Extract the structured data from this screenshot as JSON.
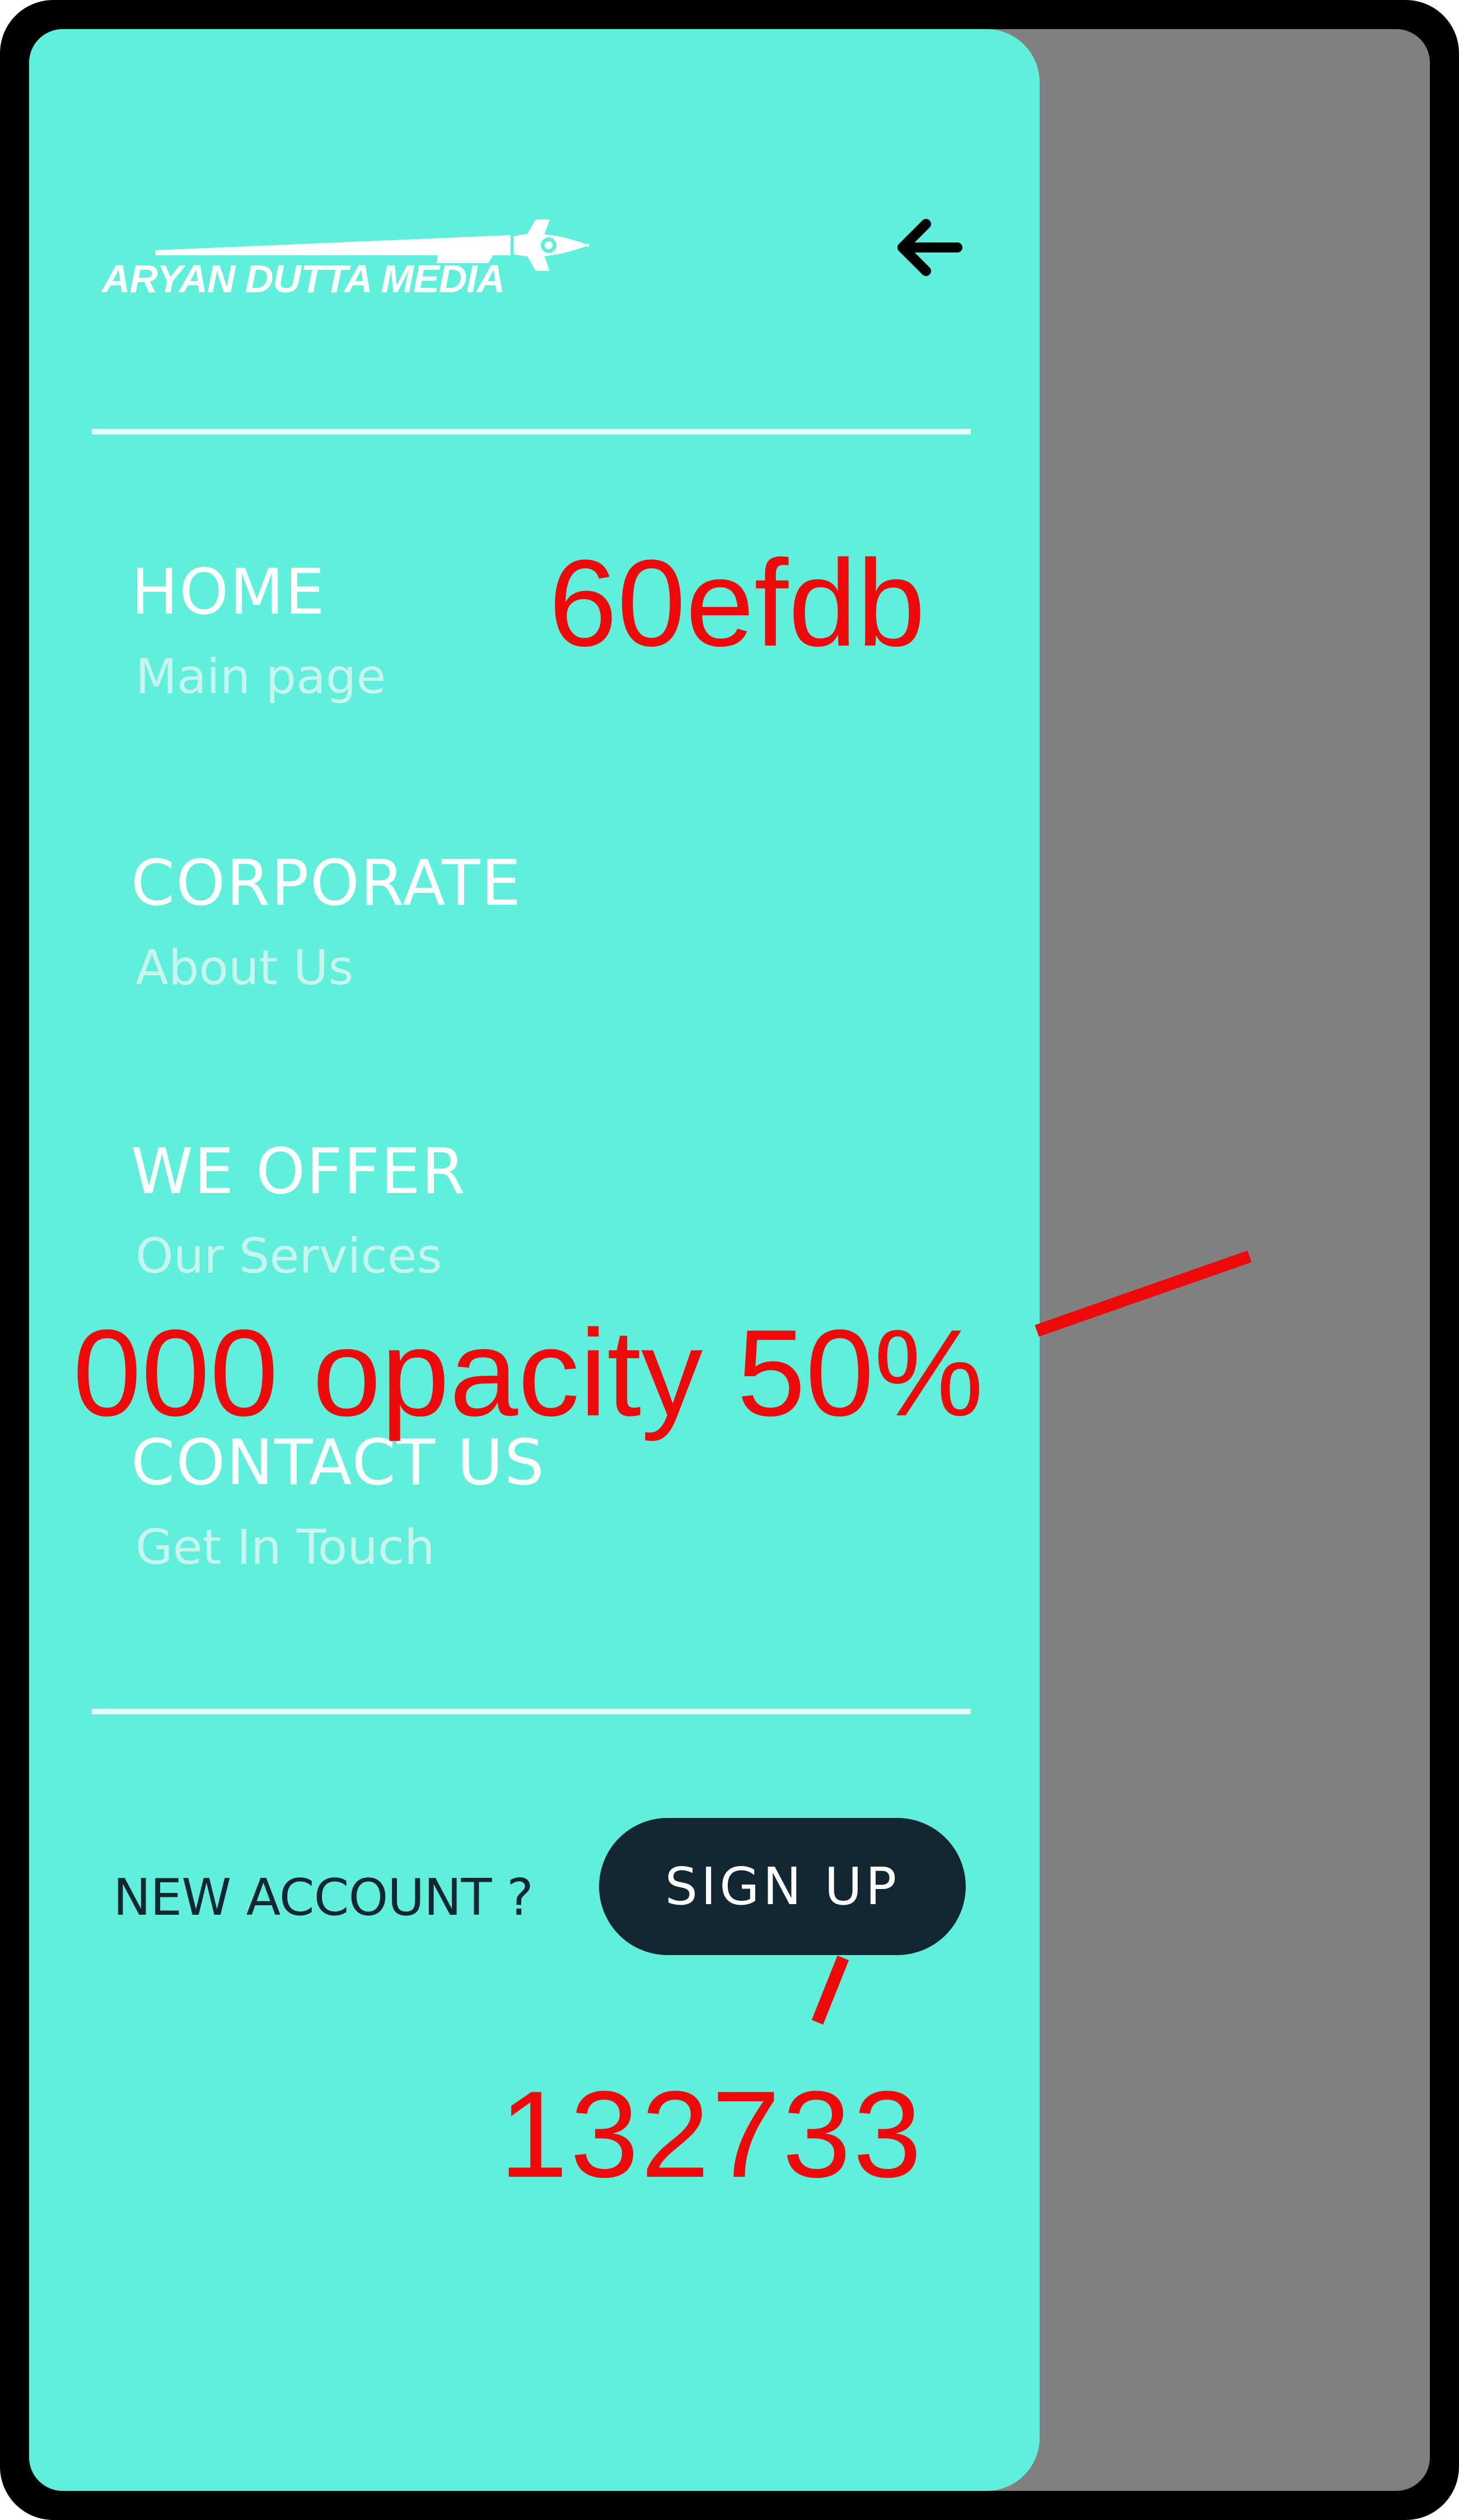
{
  "colors": {
    "drawer_background": "#60efdb",
    "overlay": "#808080",
    "button_background": "#132733",
    "annotation": "#ee0a0a"
  },
  "brand": {
    "logo_text": "ARYAN DUTTA MEDIA",
    "logo_icon": "rocket-icon"
  },
  "header": {
    "back_icon": "arrow-left-icon"
  },
  "menu": {
    "items": [
      {
        "title": "HOME",
        "subtitle": "Main page"
      },
      {
        "title": "CORPORATE",
        "subtitle": "About Us"
      },
      {
        "title": "WE OFFER",
        "subtitle": "Our Services"
      },
      {
        "title": "CONTACT US",
        "subtitle": "Get In Touch"
      }
    ]
  },
  "footer": {
    "prompt": "NEW ACCOUNT ?",
    "signup_label": "SIGN UP"
  },
  "annotations": {
    "drawer_color": "60efdb",
    "overlay_note": "000 opacity 50%",
    "button_color": "132733"
  }
}
